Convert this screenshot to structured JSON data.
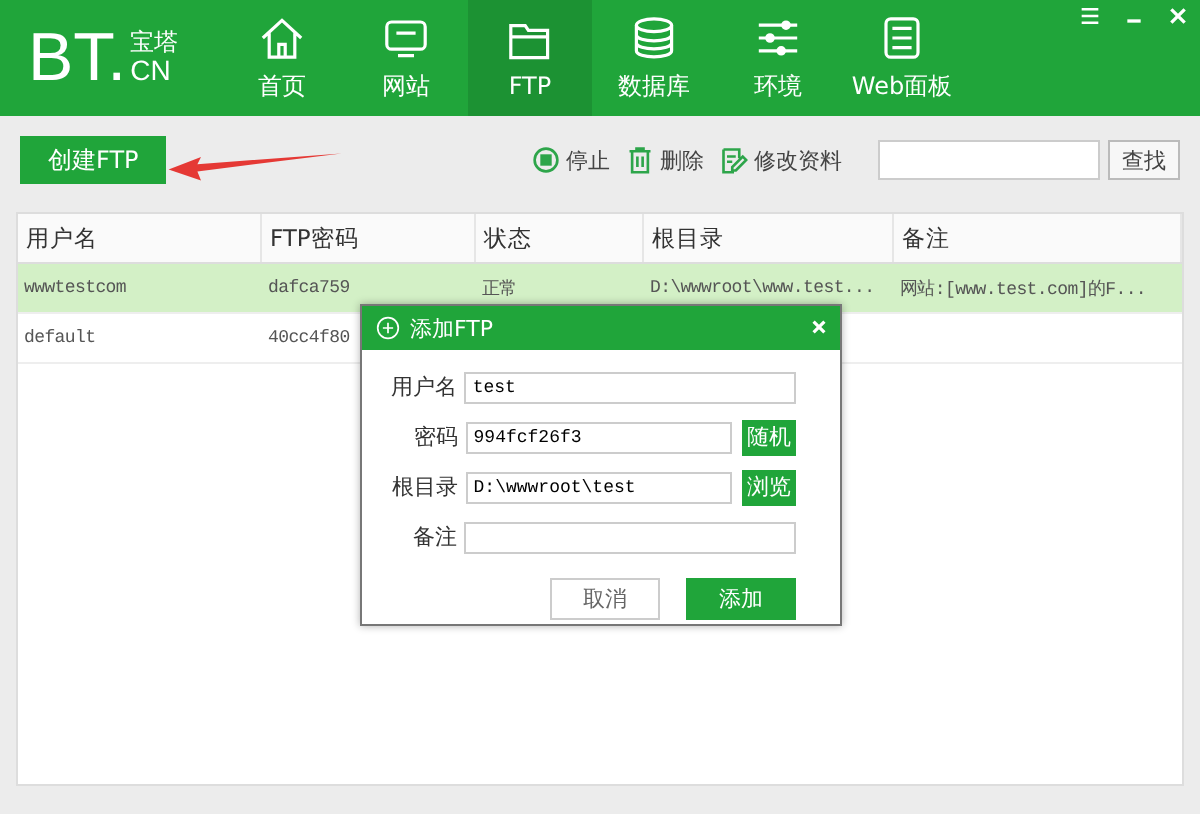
{
  "logo": {
    "main": "BT.",
    "cn": "宝塔",
    "domain": "CN"
  },
  "nav": [
    {
      "label": "首页",
      "selected": false
    },
    {
      "label": "网站",
      "selected": false
    },
    {
      "label": "FTP",
      "selected": true
    },
    {
      "label": "数据库",
      "selected": false
    },
    {
      "label": "环境",
      "selected": false
    },
    {
      "label": "Web面板",
      "selected": false
    }
  ],
  "toolbar": {
    "create_button": "创建FTP",
    "actions": [
      {
        "label": "停止"
      },
      {
        "label": "删除"
      },
      {
        "label": "修改资料"
      }
    ],
    "search_button": "查找"
  },
  "table": {
    "columns": [
      "用户名",
      "FTP密码",
      "状态",
      "根目录",
      "备注"
    ],
    "rows": [
      {
        "selected": true,
        "cells": [
          "wwwtestcom",
          "dafca759",
          "正常",
          "D:\\wwwroot\\www.test...",
          "网站:[www.test.com]的F..."
        ]
      },
      {
        "selected": false,
        "cells": [
          "default",
          "40cc4f80"
        ]
      }
    ]
  },
  "dialog": {
    "title": "添加FTP",
    "fields": [
      {
        "label": "用户名",
        "value": "test"
      },
      {
        "label": "密码",
        "value": "994fcf26f3",
        "button": "随机"
      },
      {
        "label": "根目录",
        "value": "D:\\wwwroot\\test",
        "button": "浏览"
      },
      {
        "label": "备注"
      }
    ],
    "cancel": "取消",
    "submit": "添加"
  }
}
